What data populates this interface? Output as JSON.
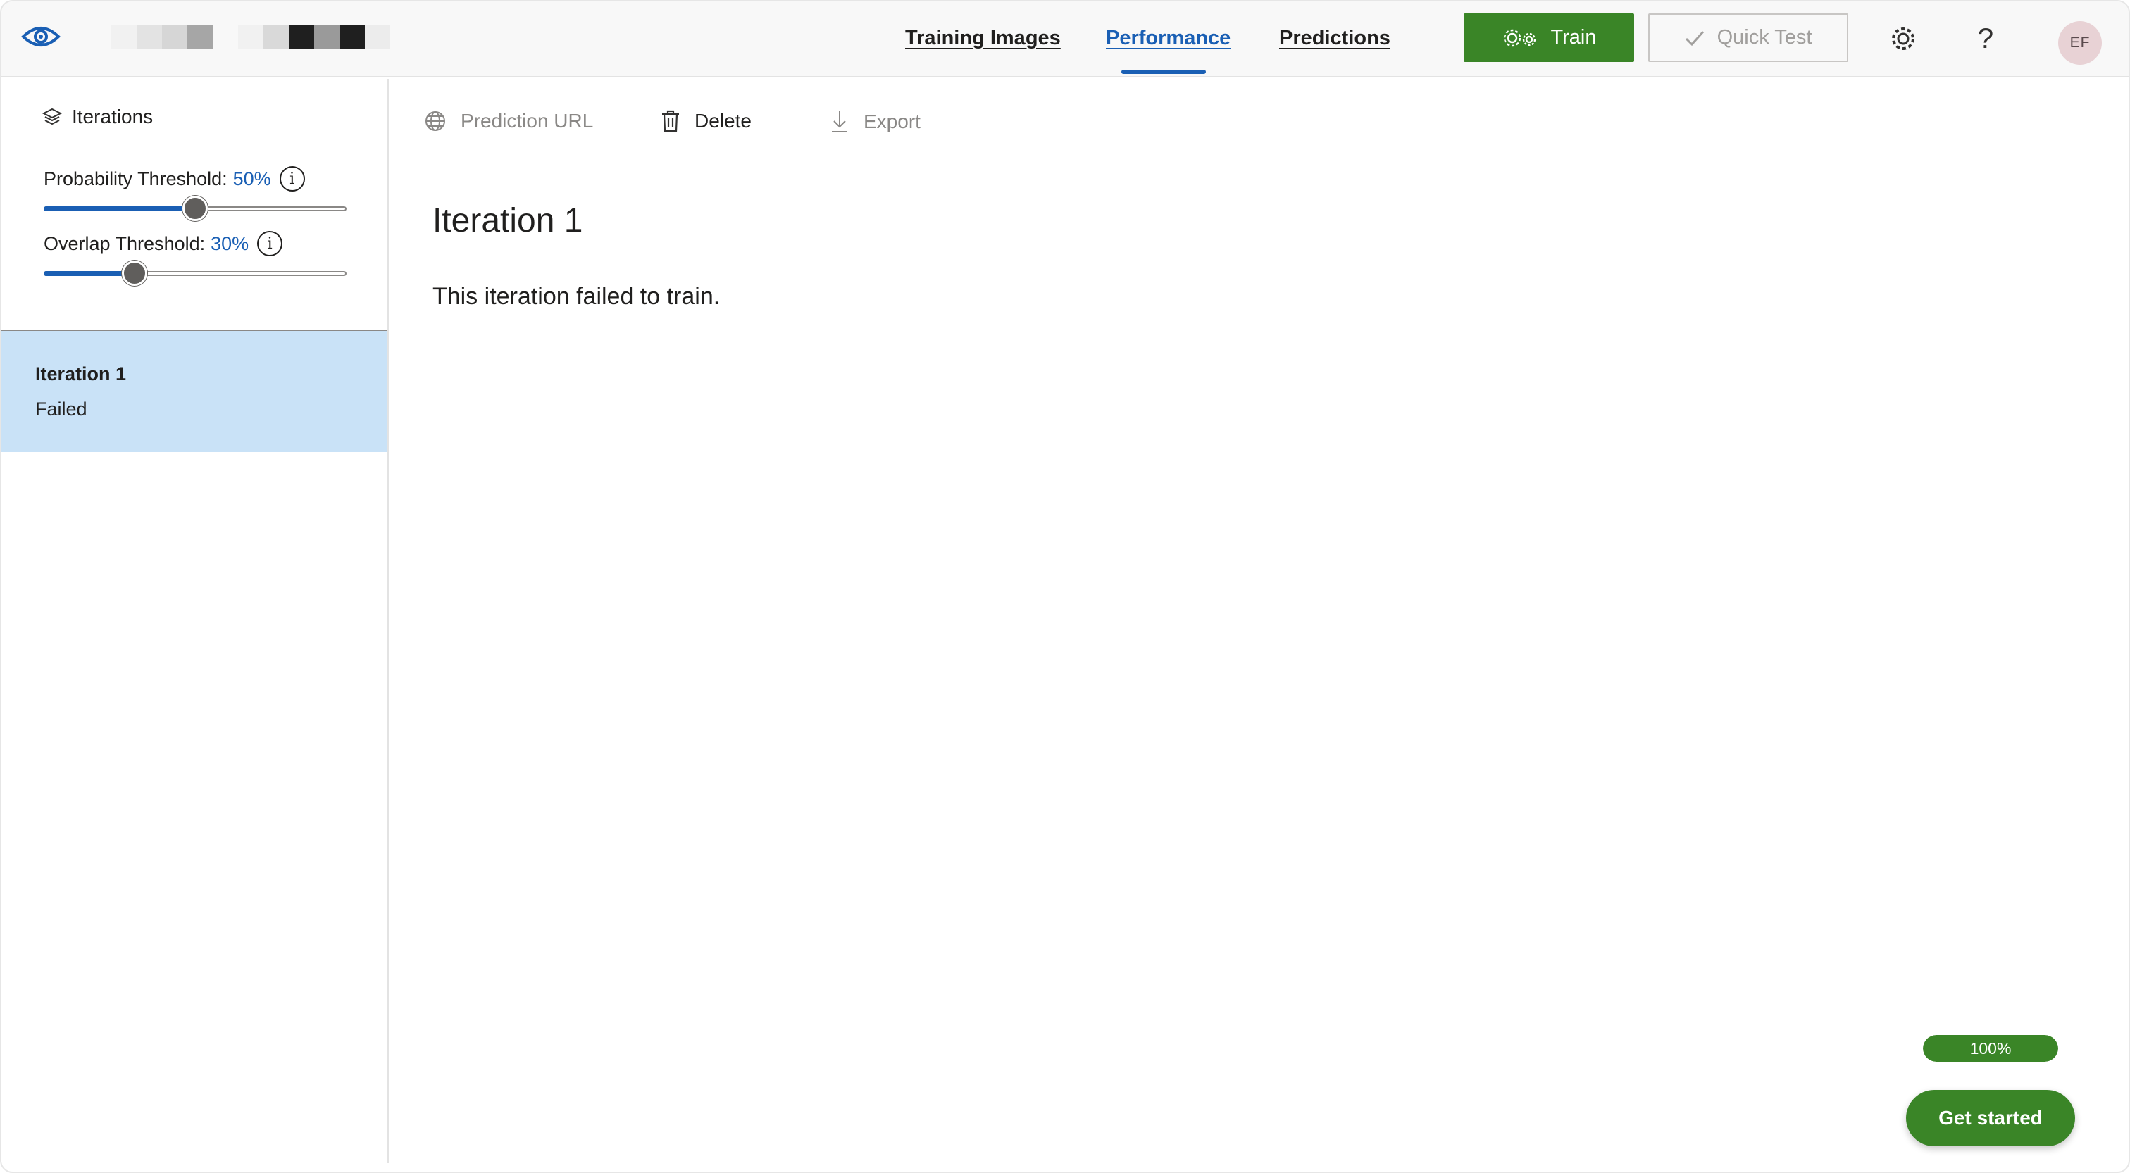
{
  "colors": {
    "accent_blue": "#1a5fb4",
    "train_green": "#3a8527",
    "selected_iteration_bg": "#c9e2f7",
    "avatar_bg": "#e8d2d5"
  },
  "header": {
    "logo_icon": "eye-icon",
    "nav": [
      {
        "label": "Training Images",
        "active": false
      },
      {
        "label": "Performance",
        "active": true
      },
      {
        "label": "Predictions",
        "active": false
      }
    ],
    "train_label": "Train",
    "train_icon": "gears-icon",
    "quick_test_label": "Quick Test",
    "quick_test_icon": "checkmark-icon",
    "settings_icon": "gear-icon",
    "help_label": "?",
    "avatar_initials": "EF"
  },
  "sidebar": {
    "title": "Iterations",
    "title_icon": "layers-icon",
    "probability": {
      "label": "Probability Threshold:",
      "value": "50%",
      "level": 0.5
    },
    "overlap": {
      "label": "Overlap Threshold:",
      "value": "30%",
      "level": 0.3
    },
    "info_label": "i",
    "iterations": [
      {
        "name": "Iteration 1",
        "status": "Failed",
        "selected": true
      }
    ]
  },
  "toolbar": {
    "prediction_url": "Prediction URL",
    "delete": "Delete",
    "export": "Export"
  },
  "main": {
    "title": "Iteration 1",
    "message": "This iteration failed to train."
  },
  "footer": {
    "progress_label": "100%",
    "progress_value": 1.0,
    "get_started": "Get started"
  }
}
